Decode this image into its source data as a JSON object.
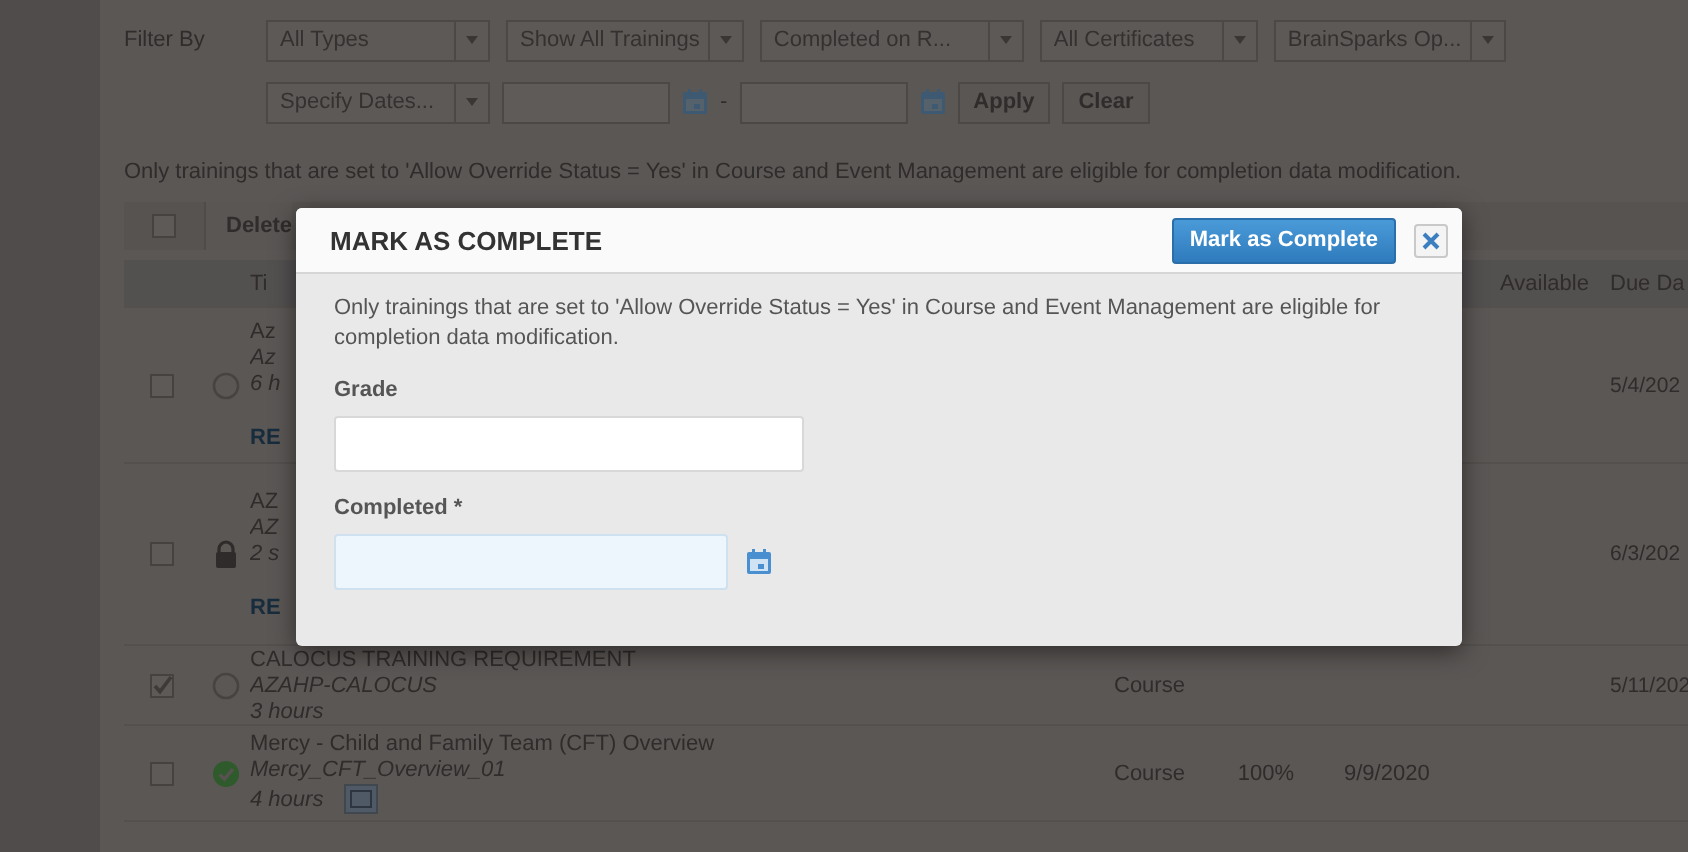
{
  "filters": {
    "label": "Filter By",
    "selects": [
      "All Types",
      "Show All Trainings",
      "Completed on R...",
      "All Certificates",
      "BrainSparks Op..."
    ],
    "date_select": "Specify Dates...",
    "date_separator": "-",
    "buttons": [
      "Apply",
      "Clear"
    ]
  },
  "notice": "Only trainings that are set to 'Allow Override Status = Yes' in Course and Event Management are eligible for completion data modification.",
  "toolbar": {
    "select_all_checked": false,
    "actions": [
      "Delete"
    ]
  },
  "table": {
    "columns": {
      "title": "Ti",
      "available": "Available",
      "due_date": "Due Da"
    },
    "rows": [
      {
        "checked": false,
        "kind": "not_started",
        "title": "Az",
        "code": "Az",
        "duration": "6 h",
        "link": "RE",
        "due_date": "5/4/202"
      },
      {
        "checked": false,
        "kind": "locked",
        "title": "AZ",
        "code": "AZ",
        "duration": "2 s",
        "link": "RE",
        "due_date": "6/3/202"
      },
      {
        "checked": true,
        "kind": "not_started",
        "title": "CALOCUS TRAINING REQUIREMENT",
        "code": "AZAHP-CALOCUS",
        "duration": "3 hours",
        "type": "Course",
        "due_date": "5/11/202"
      },
      {
        "checked": false,
        "kind": "completed",
        "title": "Mercy - Child and Family Team (CFT) Overview",
        "code": "Mercy_CFT_Overview_01",
        "duration": "4 hours",
        "media": true,
        "type": "Course",
        "score": "100%",
        "completed": "9/9/2020"
      }
    ]
  },
  "modal": {
    "title": "MARK AS COMPLETE",
    "primary_button": "Mark as Complete",
    "notice": "Only trainings that are set to 'Allow Override Status = Yes' in Course and Event Management are eligible for completion data modification.",
    "fields": [
      {
        "label": "Grade",
        "kind": "text"
      },
      {
        "label": "Completed *",
        "kind": "date"
      }
    ]
  }
}
